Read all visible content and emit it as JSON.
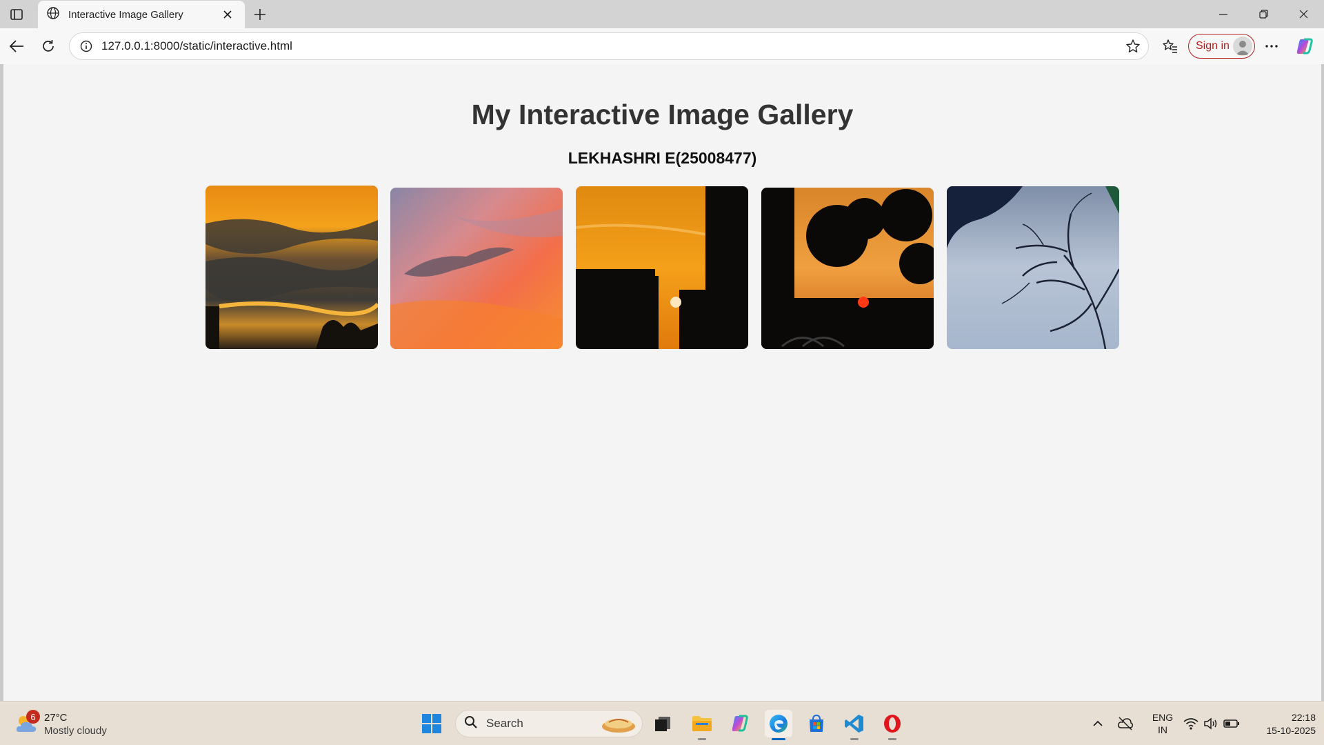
{
  "browser": {
    "tab_title": "Interactive Image Gallery",
    "url": "127.0.0.1:8000/static/interactive.html",
    "signin_label": "Sign in",
    "icons": [
      "tab-actions-icon",
      "globe-icon",
      "close-icon",
      "plus-icon",
      "minimize-icon",
      "restore-icon",
      "close-window-icon",
      "back-arrow-icon",
      "refresh-icon",
      "info-icon",
      "star-icon",
      "favorites-icon",
      "profile-icon",
      "more-icon",
      "copilot-icon"
    ]
  },
  "page": {
    "title": "My Interactive Image Gallery",
    "subtitle": "LEKHASHRI E(25008477)",
    "images": [
      {
        "name": "gallery-image-1",
        "description_icon": "golden-cloudy-sunset-photo"
      },
      {
        "name": "gallery-image-2",
        "description_icon": "pink-orange-sky-photo"
      },
      {
        "name": "gallery-image-3",
        "description_icon": "building-silhouette-sunset-photo"
      },
      {
        "name": "gallery-image-4",
        "description_icon": "tree-silhouette-sunset-photo"
      },
      {
        "name": "gallery-image-5",
        "description_icon": "bare-branches-blue-sky-photo"
      }
    ]
  },
  "taskbar": {
    "weather_badge": "6",
    "weather_temp": "27°C",
    "weather_desc": "Mostly cloudy",
    "search_label": "Search",
    "lang_line1": "ENG",
    "lang_line2": "IN",
    "time": "22:18",
    "date": "15-10-2025",
    "colors": {
      "accent": "#0067c0",
      "badge": "#c42b1c"
    }
  }
}
